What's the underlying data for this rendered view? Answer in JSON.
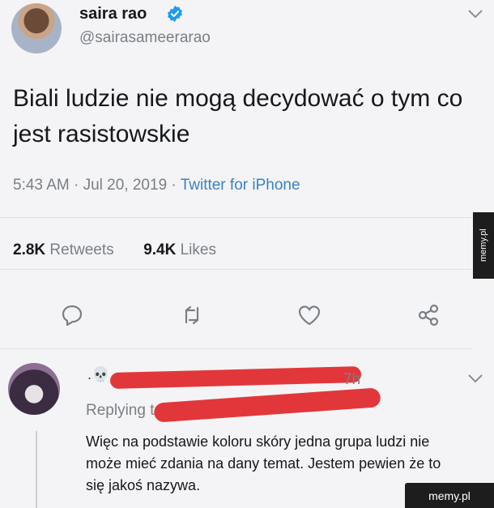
{
  "tweet": {
    "author_name": "saira rao",
    "handle": "@sairasameerarao",
    "text": "Biali ludzie nie mogą decydować o tym co jest rasistowskie",
    "time": "5:43 AM",
    "date": "Jul 20, 2019",
    "source": "Twitter for iPhone",
    "retweets_count": "2.8K",
    "retweets_label": "Retweets",
    "likes_count": "9.4K",
    "likes_label": "Likes"
  },
  "reply": {
    "author_name_prefix": ".💀",
    "time": "7h",
    "replying_label": "Replying to",
    "text": "Więc na podstawie koloru skóry jedna grupa ludzi nie może mieć zdania na dany temat. Jestem pewien że to się jakoś nazywa."
  },
  "watermark": {
    "bottom": "memy.pl",
    "side": "memy.pl"
  },
  "colors": {
    "verified": "#1d9bf0",
    "link": "#3b82c4",
    "redaction": "#e2373a",
    "muted": "#7a7f86"
  },
  "icons": [
    "verified-badge-icon",
    "chevron-down-icon",
    "reply-icon",
    "retweet-icon",
    "like-icon",
    "share-icon"
  ]
}
